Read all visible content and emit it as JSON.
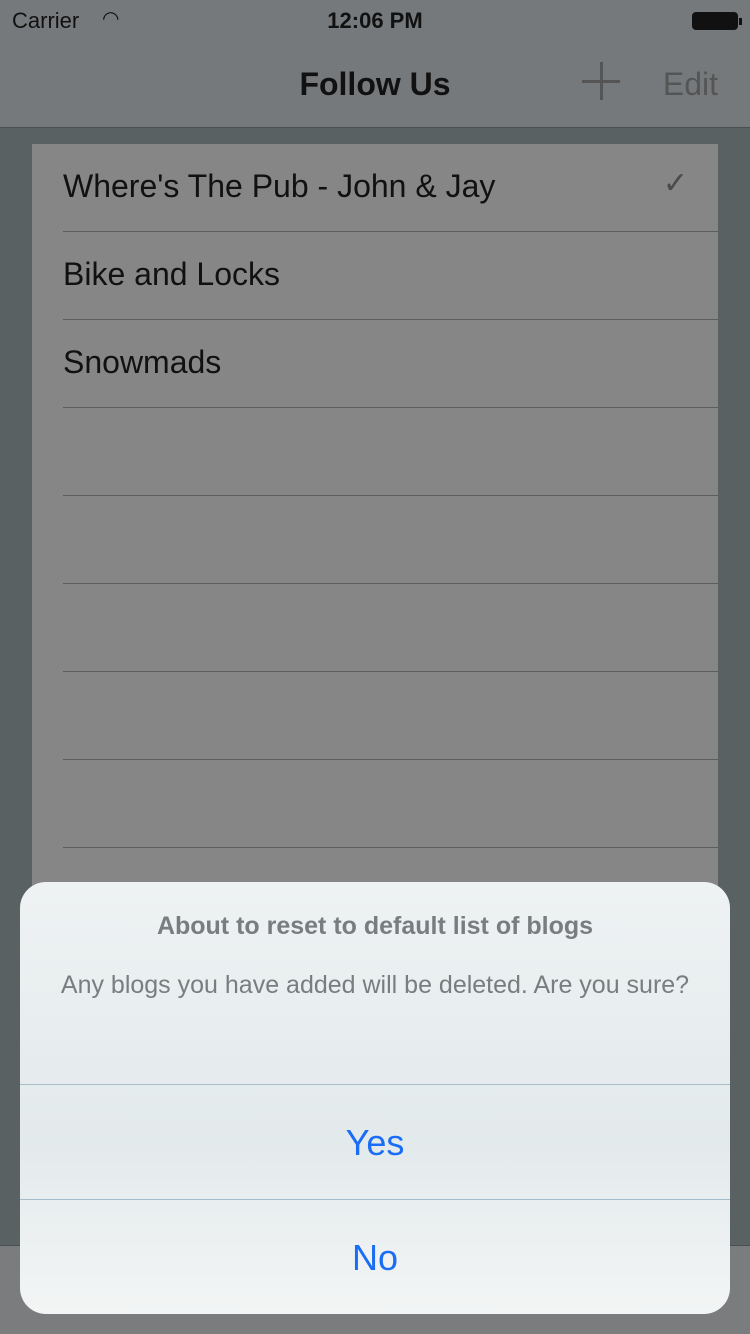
{
  "status_bar": {
    "carrier": "Carrier",
    "time": "12:06 PM"
  },
  "nav": {
    "title": "Follow Us",
    "edit_label": "Edit"
  },
  "list": {
    "items": [
      {
        "label": "Where's The Pub - John & Jay",
        "checked": true,
        "check": "✓"
      },
      {
        "label": "Bike and Locks"
      },
      {
        "label": "Snowmads"
      },
      {
        "label": ""
      },
      {
        "label": ""
      },
      {
        "label": ""
      },
      {
        "label": ""
      },
      {
        "label": ""
      }
    ]
  },
  "alert": {
    "title": "About to reset to default list of blogs",
    "message": "Any blogs you have added will be deleted.  Are you sure?",
    "yes_label": "Yes",
    "no_label": "No"
  }
}
